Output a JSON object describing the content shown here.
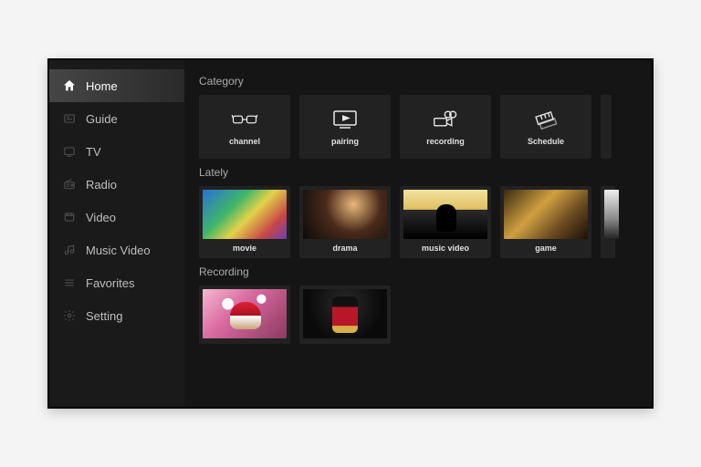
{
  "sidebar": {
    "items": [
      {
        "label": "Home",
        "icon": "home-icon",
        "active": true
      },
      {
        "label": "Guide",
        "icon": "guide-icon",
        "active": false
      },
      {
        "label": "TV",
        "icon": "tv-icon",
        "active": false
      },
      {
        "label": "Radio",
        "icon": "radio-icon",
        "active": false
      },
      {
        "label": "Video",
        "icon": "video-icon",
        "active": false
      },
      {
        "label": "Music Video",
        "icon": "music-icon",
        "active": false
      },
      {
        "label": "Favorites",
        "icon": "favorites-icon",
        "active": false
      },
      {
        "label": "Setting",
        "icon": "settings-icon",
        "active": false
      }
    ]
  },
  "sections": {
    "category": {
      "title": "Category",
      "items": [
        {
          "label": "channel",
          "icon": "glasses-icon"
        },
        {
          "label": "pairing",
          "icon": "monitor-play-icon"
        },
        {
          "label": "recording",
          "icon": "camcorder-icon"
        },
        {
          "label": "Schedule",
          "icon": "tickets-icon"
        }
      ]
    },
    "lately": {
      "title": "Lately",
      "items": [
        {
          "label": "movie"
        },
        {
          "label": "drama"
        },
        {
          "label": "music video"
        },
        {
          "label": "game"
        }
      ]
    },
    "recording": {
      "title": "Recording"
    }
  }
}
